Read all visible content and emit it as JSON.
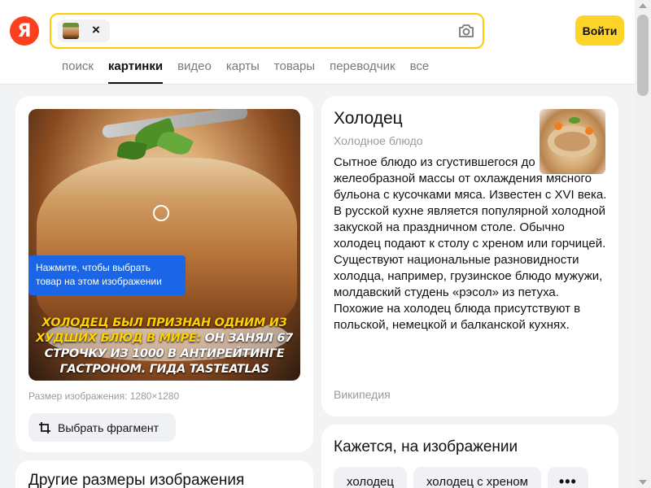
{
  "header": {
    "logo": "Я",
    "login_label": "Войти"
  },
  "search": {
    "chip_close": "×"
  },
  "tabs": [
    {
      "label": "поиск",
      "active": false
    },
    {
      "label": "картинки",
      "active": true
    },
    {
      "label": "видео",
      "active": false
    },
    {
      "label": "карты",
      "active": false
    },
    {
      "label": "товары",
      "active": false
    },
    {
      "label": "переводчик",
      "active": false
    },
    {
      "label": "все",
      "active": false
    }
  ],
  "image_card": {
    "caption_highlight": "ХОЛОДЕЦ БЫЛ ПРИЗНАН ОДНИМ ИЗ ХУДШИХ БЛЮД В МИРЕ:",
    "caption_rest": " ОН ЗАНЯЛ 67 СТРОЧКУ ИЗ 1000 В АНТИРЕЙТИНГЕ ГАСТРОНОМ. ГИДА TASTEATLAS",
    "tooltip": "Нажмите, чтобы выбрать товар на этом изображении",
    "size_label": "Размер изображения: 1280×1280",
    "fragment_button": "Выбрать фрагмент"
  },
  "other_sizes": {
    "title": "Другие размеры изображения"
  },
  "entity": {
    "title": "Холодец",
    "subtitle": "Холодное блюдо",
    "description_start": "Сытное блюдо из сгустившегося до",
    "description_rest": "желеобразной массы от охлаждения мясного бульона с кусочками мяса. Известен с XVI века. В русской кухне является популярной холодной закуской на праздничном столе. Обычно холодец подают к столу с хреном или горчицей. Существуют национальные разновидности холодца, например, грузинское блюдо мужужи, молдавский студень «рэсол» из петуха. Похожие на холодец блюда присутствуют в польской, немецкой и балканской кухнях.",
    "source": "Википедия"
  },
  "seems_like": {
    "title": "Кажется, на изображении",
    "tags": [
      "холодец",
      "холодец с хреном"
    ],
    "more": "•••"
  },
  "colors": {
    "accent_yellow": "#fed42b",
    "search_border": "#ffcc00",
    "logo_red": "#fc3f1d",
    "tooltip_blue": "#1a66e6"
  }
}
